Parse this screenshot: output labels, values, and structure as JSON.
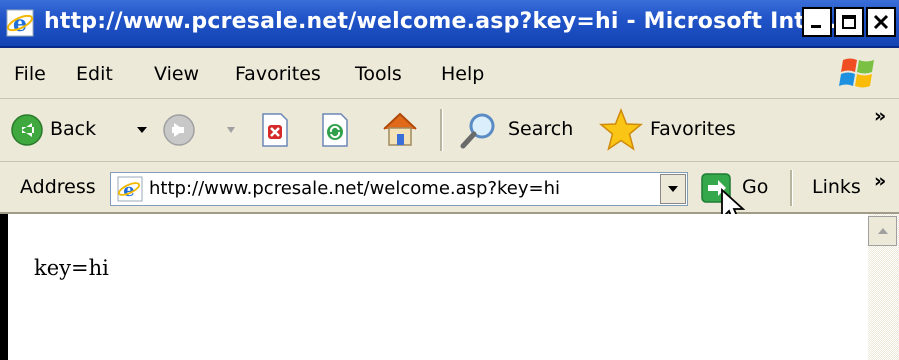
{
  "window": {
    "title": "http://www.pcresale.net/welcome.asp?key=hi - Microsoft Inter...",
    "titlebar_color": "#2054c8"
  },
  "menu": {
    "items": [
      "File",
      "Edit",
      "View",
      "Favorites",
      "Tools",
      "Help"
    ]
  },
  "toolbar": {
    "back_label": "Back",
    "search_label": "Search",
    "favorites_label": "Favorites",
    "more_chevron": "»"
  },
  "address": {
    "label": "Address",
    "value": "http://www.pcresale.net/welcome.asp?key=hi",
    "go_label": "Go",
    "links_label": "Links",
    "links_chevron": "»"
  },
  "content": {
    "text": "key=hi"
  }
}
